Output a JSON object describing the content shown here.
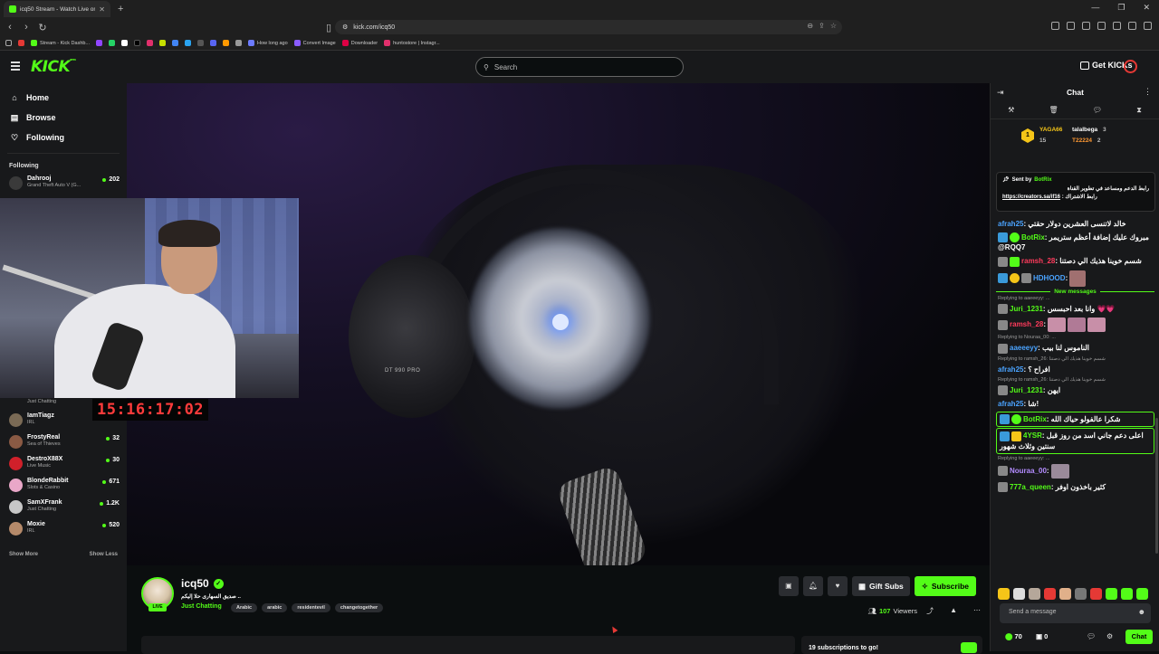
{
  "browser": {
    "tab_title": "icq50 Stream - Watch Live on Ki",
    "url": "kick.com/icq50",
    "bookmarks": [
      "Stream - Kick Dashb...",
      "How long ago",
      "Convert Image",
      "Downloader",
      "huntostore | Instagr..."
    ]
  },
  "header": {
    "logo": "KICK",
    "logo_sup": "BETA",
    "search_placeholder": "Search",
    "get_kicks": "Get KICKs"
  },
  "sidebar": {
    "nav": [
      {
        "label": "Home",
        "icon": "home-icon"
      },
      {
        "label": "Browse",
        "icon": "browse-icon"
      },
      {
        "label": "Following",
        "icon": "heart-icon"
      }
    ],
    "following_header": "Following",
    "channels": [
      {
        "name": "Dahrooj",
        "game": "Grand Theft Auto V (G...",
        "viewers": "202",
        "color": "#3a3a3a"
      },
      {
        "name": "",
        "game": "Just Chatting",
        "viewers": "",
        "color": "#3a3a3a"
      },
      {
        "name": "IamTiagz",
        "game": "IRL",
        "viewers": "",
        "color": "#7a6a55"
      },
      {
        "name": "FrostyReal",
        "game": "Sea of Thieves",
        "viewers": "32",
        "color": "#8a5a44"
      },
      {
        "name": "DestroX88X",
        "game": "Live Music",
        "viewers": "30",
        "color": "#d0202a"
      },
      {
        "name": "BlondeRabbit",
        "game": "Slots & Casino",
        "viewers": "671",
        "color": "#e9a7c8"
      },
      {
        "name": "SamXFrank",
        "game": "Just Chatting",
        "viewers": "1.2K",
        "color": "#c7c7c7"
      },
      {
        "name": "Moxie",
        "game": "IRL",
        "viewers": "520",
        "color": "#b58a6a"
      }
    ],
    "show_more": "Show More",
    "show_less": "Show Less"
  },
  "video": {
    "timer": "15:16:17:02",
    "headphone_text": "DT 990 PRO"
  },
  "stream": {
    "live": "LIVE",
    "channel": "icq50",
    "title": "صديق السهارى حلا إليكم ..",
    "category": "Just Chatting",
    "tags": [
      "Arabic",
      "arabic",
      "residentevil",
      "changetogether"
    ],
    "gift_subs": "Gift Subs",
    "subscribe": "Subscribe",
    "viewers_count": "107",
    "viewers_label": "Viewers",
    "sub_goal": "19 subscriptions to go!"
  },
  "chat": {
    "title": "Chat",
    "leaderboard": {
      "rank": "1",
      "first": {
        "name": "YAGA66",
        "count": "15"
      },
      "second": {
        "name": "talalbega",
        "count": "3"
      },
      "third": {
        "name": "T22224",
        "count": "2"
      }
    },
    "pinned": {
      "sent_by_label": "Sent by",
      "sent_by_user": "BotRix",
      "text": "رابط الدعم ومساعد في تطوير القناة",
      "link_label": "رابط الاشتراك",
      "link": "https://creators.sa/if16"
    },
    "messages": [
      {
        "user": "afrah25",
        "color": "#4aa3ff",
        "text": "خالد لاتنسى العشرين دولار حقتي",
        "badges": []
      },
      {
        "user": "BotRix",
        "color": "#53fc18",
        "text": "مبروك عليك إضافة أعظم ستريمر @RQQ7",
        "badges": [
          "#3a9ad9",
          "#53fc18"
        ]
      },
      {
        "user": "ramsh_28",
        "color": "#ff3b5c",
        "text": "شسم خوينا هذيك الي دصتنا",
        "badges": [
          "#888",
          "#53fc18"
        ]
      },
      {
        "user": "HDHOOD",
        "color": "#4aa3ff",
        "text": "",
        "badges": [
          "#3a9ad9",
          "#f5c518",
          "#888"
        ]
      }
    ],
    "new_messages": "New messages",
    "messages2": [
      {
        "reply": "Replying to aaeeeyy: ...",
        "user": "Juri_1231",
        "color": "#53fc18",
        "text": "وانا بعد احبسس 💗💗",
        "badges": [
          "#888"
        ],
        "hl": false
      },
      {
        "reply": "",
        "user": "ramsh_28",
        "color": "#ff3b5c",
        "text": "",
        "badges": [
          "#888"
        ],
        "hl": false
      },
      {
        "reply": "Replying to Nouraa_00: ...",
        "user": "aaeeeyy",
        "color": "#4aa3ff",
        "text": "الناموس لنا بيب",
        "badges": [
          "#888"
        ],
        "hl": false
      },
      {
        "reply": "Replying to ramsh_26: شسم خوينا هذيك الي دصتنا",
        "user": "afrah25",
        "color": "#4aa3ff",
        "text": "افراح ؟",
        "badges": [],
        "hl": false
      },
      {
        "reply": "Replying to ramsh_26: شسم خوينا هذيك الي دصتنا",
        "user": "Juri_1231",
        "color": "#53fc18",
        "text": "ايهن",
        "badges": [
          "#888"
        ],
        "hl": false
      },
      {
        "reply": "",
        "user": "afrah25",
        "color": "#4aa3ff",
        "text": "شا!",
        "badges": [],
        "hl": false
      },
      {
        "reply": "",
        "user": "BotRix",
        "color": "#53fc18",
        "text": "شكرا عالفولو حياك الله",
        "badges": [
          "#3a9ad9",
          "#53fc18"
        ],
        "hl": true
      },
      {
        "reply": "",
        "user": "4YSR",
        "color": "#53fc18",
        "text": "اعلى دعم جاني اسد من روز قبل سنتين وثلاث شهور",
        "badges": [
          "#3a9ad9",
          "#f5c518"
        ],
        "hl": true
      },
      {
        "reply": "Replying to aaeeeyy: ...",
        "user": "Nouraa_00",
        "color": "#b38cff",
        "text": "",
        "badges": [
          "#888"
        ],
        "hl": false
      },
      {
        "reply": "",
        "user": "777a_queen",
        "color": "#53fc18",
        "text": "كثير باخذون اوفر",
        "badges": [
          "#888"
        ],
        "hl": false
      }
    ],
    "input_placeholder": "Send a message",
    "points": "70",
    "points2": "0",
    "chat_button": "Chat",
    "emote_colors": [
      "#f5c518",
      "#ddd",
      "#b5a79a",
      "#e53935",
      "#e0b08a",
      "#777",
      "#e53935",
      "#53fc18",
      "#53fc18",
      "#53fc18"
    ]
  }
}
